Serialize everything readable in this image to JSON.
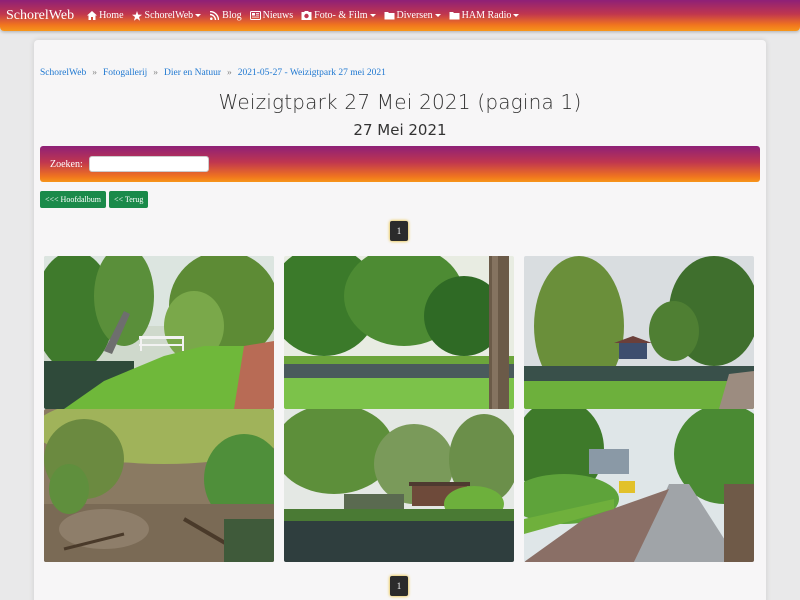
{
  "navbar": {
    "brand": "SchorelWeb",
    "items": [
      {
        "label": "Home",
        "icon": "home-icon",
        "dropdown": false
      },
      {
        "label": "SchorelWeb",
        "icon": "star-icon",
        "dropdown": true
      },
      {
        "label": "Blog",
        "icon": "rss-icon",
        "dropdown": false
      },
      {
        "label": "Nieuws",
        "icon": "newspaper-icon",
        "dropdown": false
      },
      {
        "label": "Foto- & Film",
        "icon": "camera-icon",
        "dropdown": true
      },
      {
        "label": "Diversen",
        "icon": "folder-icon",
        "dropdown": true
      },
      {
        "label": "HAM Radio",
        "icon": "folder-icon",
        "dropdown": true
      }
    ]
  },
  "breadcrumb": [
    "SchorelWeb",
    "Fotogallerij",
    "Dier en Natuur",
    "2021-05-27 - Weizigtpark 27 mei 2021"
  ],
  "page": {
    "title": "Weizigtpark 27 Mei 2021 (pagina 1)",
    "subtitle": "27 Mei 2021"
  },
  "search": {
    "label": "Zoeken:",
    "value": ""
  },
  "buttons": {
    "main_album": "<<< Hoofdalbum",
    "back": "<< Terug"
  },
  "pagination": {
    "current_page": "1"
  },
  "colors": {
    "gradient_top": "#8e2077",
    "gradient_bottom": "#f7961a",
    "button_green": "#1a8a4a",
    "link_blue": "#1f78d1"
  }
}
